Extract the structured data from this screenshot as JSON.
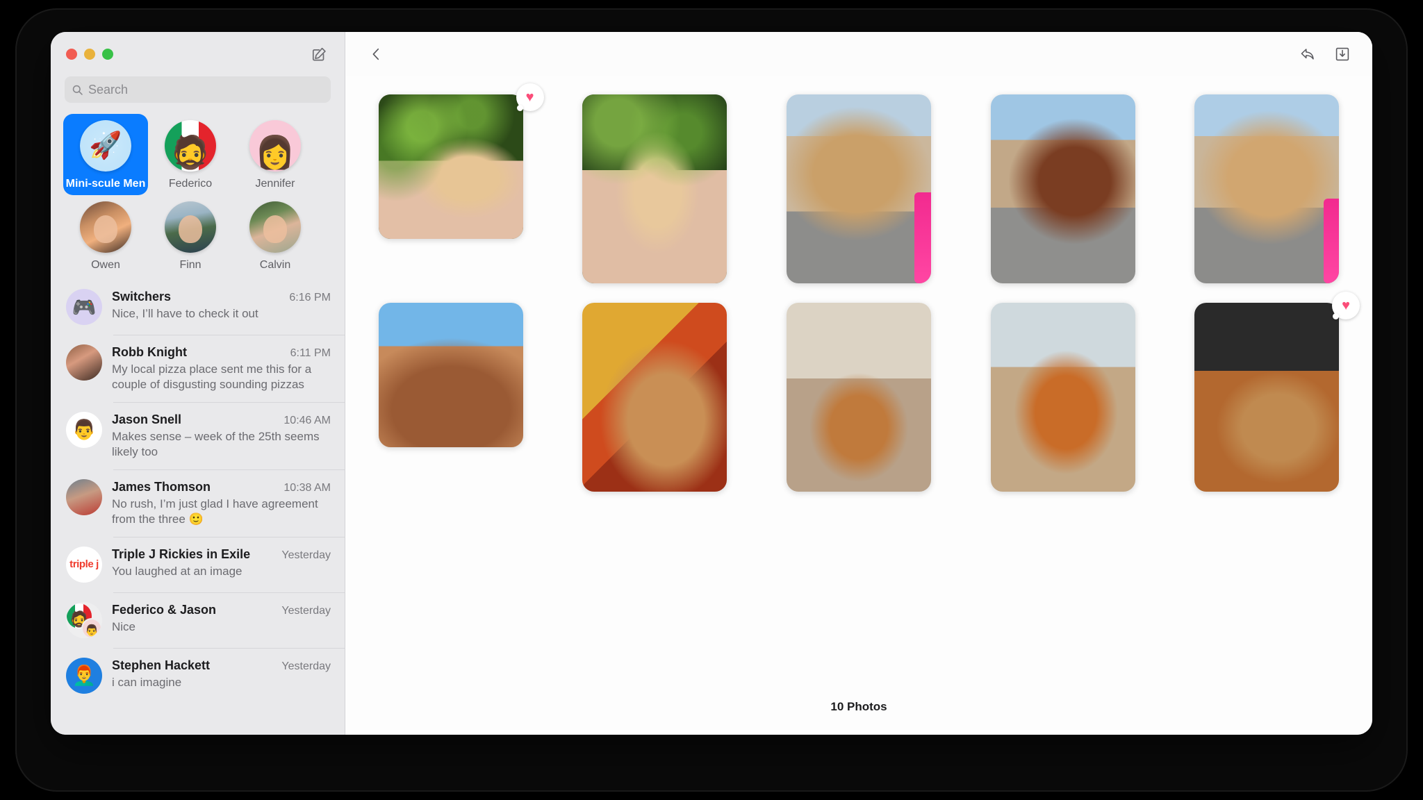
{
  "window": {
    "traffic_lights": [
      "close",
      "minimize",
      "zoom"
    ],
    "compose_label": "compose"
  },
  "search": {
    "placeholder": "Search",
    "value": ""
  },
  "pinned": [
    {
      "name": "Mini-scule Men",
      "avatar": "rocket",
      "glyph": "🚀",
      "selected": true
    },
    {
      "name": "Federico",
      "avatar": "memoji-federico",
      "glyph": "🧔",
      "selected": false
    },
    {
      "name": "Jennifer",
      "avatar": "memoji-jennifer",
      "glyph": "👩",
      "selected": false
    },
    {
      "name": "Owen",
      "avatar": "photo-owen",
      "glyph": "",
      "selected": false
    },
    {
      "name": "Finn",
      "avatar": "photo-finn",
      "glyph": "",
      "selected": false
    },
    {
      "name": "Calvin",
      "avatar": "photo-calvin",
      "glyph": "",
      "selected": false
    }
  ],
  "conversations": [
    {
      "name": "Switchers",
      "time": "6:16 PM",
      "preview": "Nice, I’ll have to check it out",
      "avatar": "switchers",
      "glyph": "🎮"
    },
    {
      "name": "Robb Knight",
      "time": "6:11 PM",
      "preview": "My local pizza place sent me this for a couple of disgusting sounding pizzas",
      "avatar": "robb",
      "glyph": ""
    },
    {
      "name": "Jason Snell",
      "time": "10:46 AM",
      "preview": "Makes sense – week of the 25th seems likely too",
      "avatar": "jason",
      "glyph": "👨"
    },
    {
      "name": "James Thomson",
      "time": "10:38 AM",
      "preview": "No rush, I’m just glad I have agreement from the three 🙂",
      "avatar": "james",
      "glyph": ""
    },
    {
      "name": "Triple J Rickies in Exile",
      "time": "Yesterday",
      "preview": "You laughed at an image",
      "avatar": "triplej",
      "glyph": "",
      "logo_text": "triple j"
    },
    {
      "name": "Federico & Jason",
      "time": "Yesterday",
      "preview": "Nice",
      "avatar": "fedjason",
      "glyph": ""
    },
    {
      "name": "Stephen Hackett",
      "time": "Yesterday",
      "preview": "i can imagine",
      "avatar": "stephen",
      "glyph": "👨‍🦰"
    }
  ],
  "detail": {
    "toolbar": {
      "back_label": "Back",
      "reply_label": "Reply",
      "save_label": "Save"
    },
    "photo_count": "10 Photos",
    "photos": [
      {
        "id": "p1",
        "alt": "scruffy tan dog on path by green hedge",
        "shape": "small",
        "tapback": "heart"
      },
      {
        "id": "p2",
        "alt": "tan dog standing on paved path by hedge",
        "shape": "tall",
        "tapback": ""
      },
      {
        "id": "p3",
        "alt": "dog resting head on sand at the beach",
        "shape": "tall",
        "tapback": ""
      },
      {
        "id": "p4",
        "alt": "brown dog lying on sand close up",
        "shape": "tall",
        "tapback": ""
      },
      {
        "id": "p5",
        "alt": "tan dog lying on sand with pink leash",
        "shape": "tall",
        "tapback": ""
      },
      {
        "id": "p6",
        "alt": "close-up of dog face under blue sky",
        "shape": "small",
        "tapback": ""
      },
      {
        "id": "p7",
        "alt": "dog resting on orange patterned rug",
        "shape": "tall",
        "tapback": ""
      },
      {
        "id": "p8",
        "alt": "dog sitting on the beach at sunset",
        "shape": "tall",
        "tapback": ""
      },
      {
        "id": "p9",
        "alt": "happy dog on beach with tongue out",
        "shape": "tall",
        "tapback": ""
      },
      {
        "id": "p10",
        "alt": "two dogs lying on wooden floor indoors",
        "shape": "tall",
        "tapback": "heart"
      }
    ],
    "tapback_glyph": "♥"
  },
  "colors": {
    "accent": "#0a7cff",
    "tapback_heart": "#fb4d79",
    "sidebar_bg": "#e9e9eb",
    "detail_bg": "#fdfdfd"
  }
}
